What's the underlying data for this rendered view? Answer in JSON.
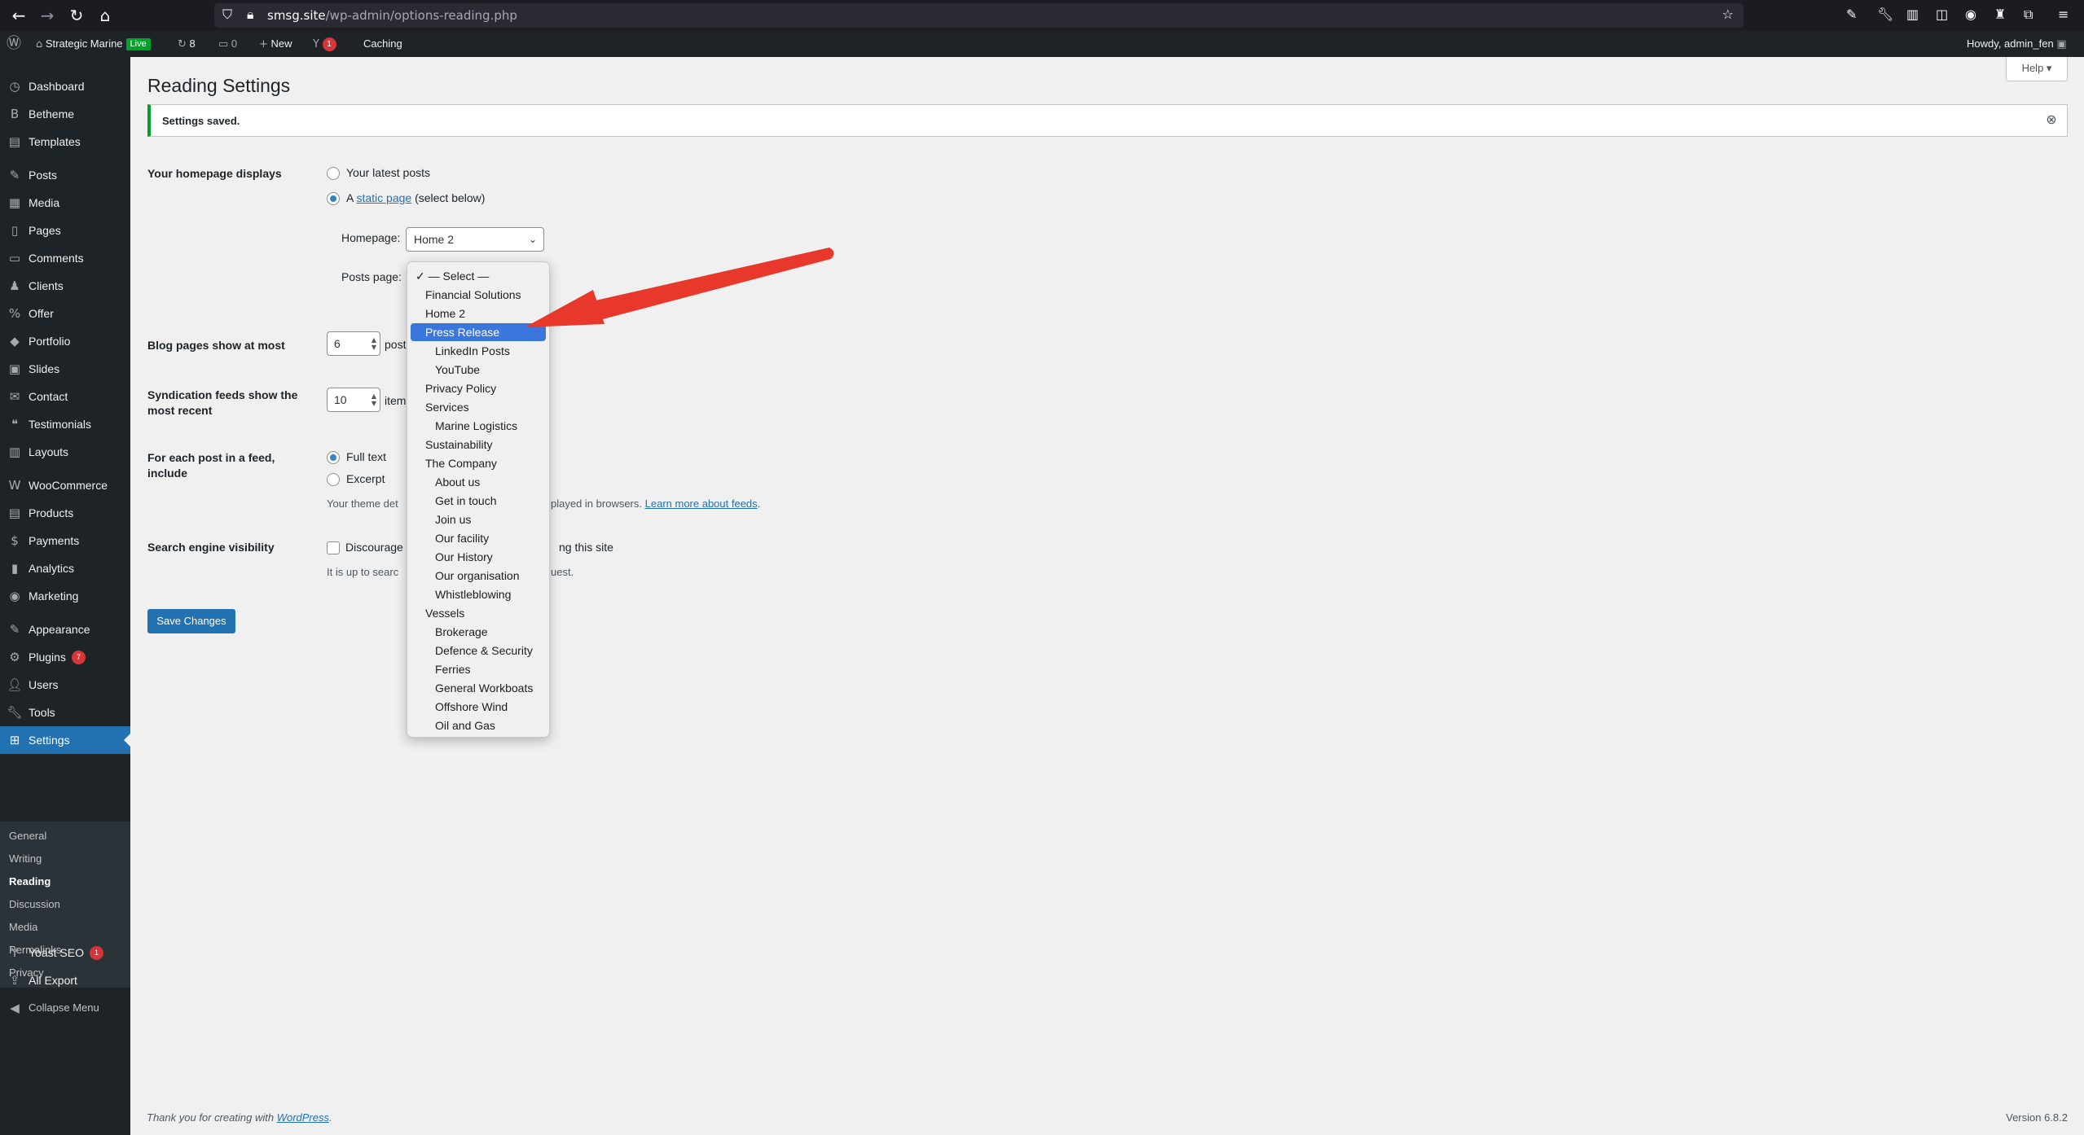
{
  "browser": {
    "url_host": "smsg.site",
    "url_path": "/wp-admin/options-reading.php",
    "icons": [
      "back-icon",
      "forward-icon",
      "reload-icon",
      "home-icon",
      "shield-icon",
      "lock-icon",
      "bookmark-star-icon"
    ]
  },
  "adminbar": {
    "site_name": "Strategic Marine",
    "live_badge": "Live",
    "updates_count": "8",
    "comments_count": "0",
    "new_label": "New",
    "yoast_count": "1",
    "caching_label": "Caching",
    "howdy": "Howdy, admin_fen"
  },
  "sidebar": {
    "items": [
      {
        "label": "Dashboard",
        "icon": "dashboard-icon"
      },
      {
        "label": "Betheme",
        "icon": "betheme-icon"
      },
      {
        "label": "Templates",
        "icon": "templates-icon"
      },
      {
        "label": "Posts",
        "icon": "pin-icon"
      },
      {
        "label": "Media",
        "icon": "media-icon"
      },
      {
        "label": "Pages",
        "icon": "pages-icon"
      },
      {
        "label": "Comments",
        "icon": "comments-icon"
      },
      {
        "label": "Clients",
        "icon": "clients-icon"
      },
      {
        "label": "Offer",
        "icon": "offer-icon"
      },
      {
        "label": "Portfolio",
        "icon": "portfolio-icon"
      },
      {
        "label": "Slides",
        "icon": "slides-icon"
      },
      {
        "label": "Contact",
        "icon": "contact-icon"
      },
      {
        "label": "Testimonials",
        "icon": "testimonials-icon"
      },
      {
        "label": "Layouts",
        "icon": "layouts-icon"
      },
      {
        "label": "WooCommerce",
        "icon": "woocommerce-icon"
      },
      {
        "label": "Products",
        "icon": "products-icon"
      },
      {
        "label": "Payments",
        "icon": "payments-icon"
      },
      {
        "label": "Analytics",
        "icon": "analytics-icon"
      },
      {
        "label": "Marketing",
        "icon": "marketing-icon"
      },
      {
        "label": "Appearance",
        "icon": "appearance-icon"
      },
      {
        "label": "Plugins",
        "icon": "plugins-icon",
        "badge": "7"
      },
      {
        "label": "Users",
        "icon": "users-icon"
      },
      {
        "label": "Tools",
        "icon": "tools-icon"
      },
      {
        "label": "Settings",
        "icon": "settings-icon"
      },
      {
        "label": "Yoast SEO",
        "icon": "yoast-icon",
        "badge": "1"
      },
      {
        "label": "All Export",
        "icon": "all-export-icon"
      },
      {
        "label": "Collapse Menu",
        "icon": "collapse-icon"
      }
    ],
    "submenu": [
      "General",
      "Writing",
      "Reading",
      "Discussion",
      "Media",
      "Permalinks",
      "Privacy"
    ]
  },
  "page": {
    "help_label": "Help ▾",
    "title": "Reading Settings",
    "notice": "Settings saved.",
    "homepage_displays_label": "Your homepage displays",
    "latest_posts_label": "Your latest posts",
    "static_page_prefix": "A",
    "static_page_link": "static page",
    "static_page_suffix": "(select below)",
    "homepage_label": "Homepage:",
    "homepage_value": "Home 2",
    "posts_page_label": "Posts page:",
    "blog_pages_label": "Blog pages show at most",
    "blog_pages_value": "6",
    "blog_pages_unit": "post",
    "syndication_label_1": "Syndication feeds show the",
    "syndication_label_2": "most recent",
    "syndication_value": "10",
    "syndication_unit": "item",
    "feed_include_label_1": "For each post in a feed,",
    "feed_include_label_2": "include",
    "full_text_label": "Full text",
    "excerpt_label": "Excerpt",
    "theme_note_start": "Your theme det",
    "theme_note_end": "played in browsers.",
    "learn_more_link": "Learn more about feeds",
    "search_visibility_label": "Search engine visibility",
    "discourage_start": "Discourage",
    "discourage_end": "ng this site",
    "search_note_start": "It is up to searc",
    "search_note_end": "uest.",
    "save_button": "Save Changes"
  },
  "dropdown": {
    "selected_index": 3,
    "options": [
      {
        "label": "✓ — Select —",
        "indent": 0
      },
      {
        "label": "Financial Solutions",
        "indent": 0
      },
      {
        "label": "Home 2",
        "indent": 0
      },
      {
        "label": "Press Release",
        "indent": 0
      },
      {
        "label": "LinkedIn Posts",
        "indent": 1
      },
      {
        "label": "YouTube",
        "indent": 1
      },
      {
        "label": "Privacy Policy",
        "indent": 0
      },
      {
        "label": "Services",
        "indent": 0
      },
      {
        "label": "Marine Logistics",
        "indent": 1
      },
      {
        "label": "Sustainability",
        "indent": 0
      },
      {
        "label": "The Company",
        "indent": 0
      },
      {
        "label": "About us",
        "indent": 1
      },
      {
        "label": "Get in touch",
        "indent": 1
      },
      {
        "label": "Join us",
        "indent": 1
      },
      {
        "label": "Our facility",
        "indent": 1
      },
      {
        "label": "Our History",
        "indent": 1
      },
      {
        "label": "Our organisation",
        "indent": 1
      },
      {
        "label": "Whistleblowing",
        "indent": 1
      },
      {
        "label": "Vessels",
        "indent": 0
      },
      {
        "label": "Brokerage",
        "indent": 1
      },
      {
        "label": "Defence & Security",
        "indent": 1
      },
      {
        "label": "Ferries",
        "indent": 1
      },
      {
        "label": "General Workboats",
        "indent": 1
      },
      {
        "label": "Offshore Wind",
        "indent": 1
      },
      {
        "label": "Oil and Gas",
        "indent": 1
      }
    ]
  },
  "footer": {
    "thanks_prefix": "Thank you for creating with",
    "thanks_link": "WordPress",
    "thanks_suffix": ".",
    "version": "Version 6.8.2"
  },
  "colors": {
    "accent": "#2271b1",
    "sidebar_bg": "#1d2327",
    "notice_success": "#00a32a",
    "annotation_arrow": "#e8382c",
    "dropdown_highlight": "#3b76dc"
  }
}
